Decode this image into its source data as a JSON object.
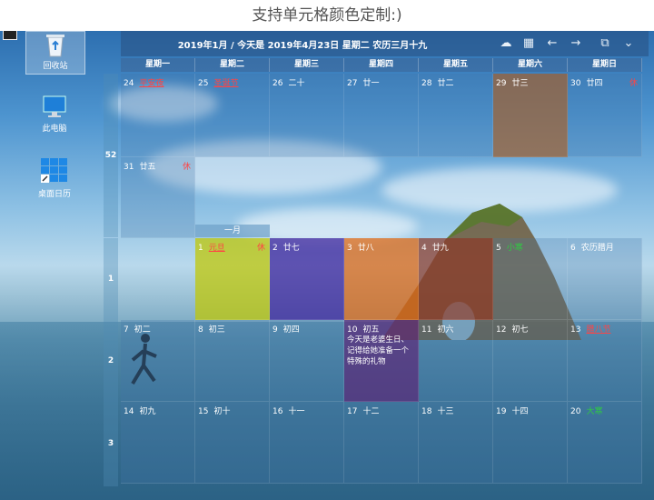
{
  "caption": "支持单元格颜色定制:)",
  "desktop_icons": [
    {
      "name": "recycle-bin",
      "label": "回收站"
    },
    {
      "name": "this-pc",
      "label": "此电脑"
    },
    {
      "name": "desktop-calendar",
      "label": "桌面日历"
    }
  ],
  "calendar": {
    "header_date": "2019年1月 / 今天是 2019年4月23日 星期二 农历三月十九",
    "toolbar": [
      "cloud-icon",
      "calendar-icon",
      "prev-arrow-icon",
      "next-arrow-icon",
      "window-icon",
      "chevron-down-icon"
    ],
    "weekdays": [
      "星期一",
      "星期二",
      "星期三",
      "星期四",
      "星期五",
      "星期六",
      "星期日"
    ],
    "month_label": "一月",
    "week_numbers": [
      "52",
      "1",
      "2",
      "3"
    ],
    "rest_label": "休",
    "rows": [
      [
        {
          "d": "24",
          "l": "平安夜",
          "style": "hol"
        },
        {
          "d": "25",
          "l": "圣诞节",
          "style": "hol"
        },
        {
          "d": "26",
          "l": "二十"
        },
        {
          "d": "27",
          "l": "廿一"
        },
        {
          "d": "28",
          "l": "廿二"
        },
        {
          "d": "29",
          "l": "廿三"
        },
        {
          "d": "30",
          "l": "廿四",
          "rest": true
        }
      ],
      [
        {
          "d": "31",
          "l": "廿五",
          "rest": true
        }
      ],
      [
        {
          "d": "1",
          "l": "元旦",
          "style": "hol",
          "rest": true
        },
        {
          "d": "2",
          "l": "廿七"
        },
        {
          "d": "3",
          "l": "廿八"
        },
        {
          "d": "4",
          "l": "廿九"
        },
        {
          "d": "5",
          "l": "小寒",
          "style": "green"
        },
        {
          "d": "6",
          "l": "农历腊月"
        }
      ],
      [
        {
          "d": "7",
          "l": "初二"
        },
        {
          "d": "8",
          "l": "初三"
        },
        {
          "d": "9",
          "l": "初四"
        },
        {
          "d": "10",
          "l": "初五",
          "note": "今天是老婆生日、记得给她准备一个特殊的礼物"
        },
        {
          "d": "11",
          "l": "初六"
        },
        {
          "d": "12",
          "l": "初七"
        },
        {
          "d": "13",
          "l": "腊八节",
          "style": "hol"
        }
      ],
      [
        {
          "d": "14",
          "l": "初九"
        },
        {
          "d": "15",
          "l": "初十"
        },
        {
          "d": "16",
          "l": "十一"
        },
        {
          "d": "17",
          "l": "十二"
        },
        {
          "d": "18",
          "l": "十三"
        },
        {
          "d": "19",
          "l": "十四"
        },
        {
          "d": "20",
          "l": "大寒",
          "style": "green"
        }
      ]
    ],
    "cell_colors": {
      "row0_col5": "#a0602f",
      "row2_col1": "#c0c800",
      "row2_col2": "#3a1e9a",
      "row2_col3": "#e0660f",
      "row2_col4": "#8a3a2a",
      "row3_col3": "#5a2a7a"
    }
  }
}
